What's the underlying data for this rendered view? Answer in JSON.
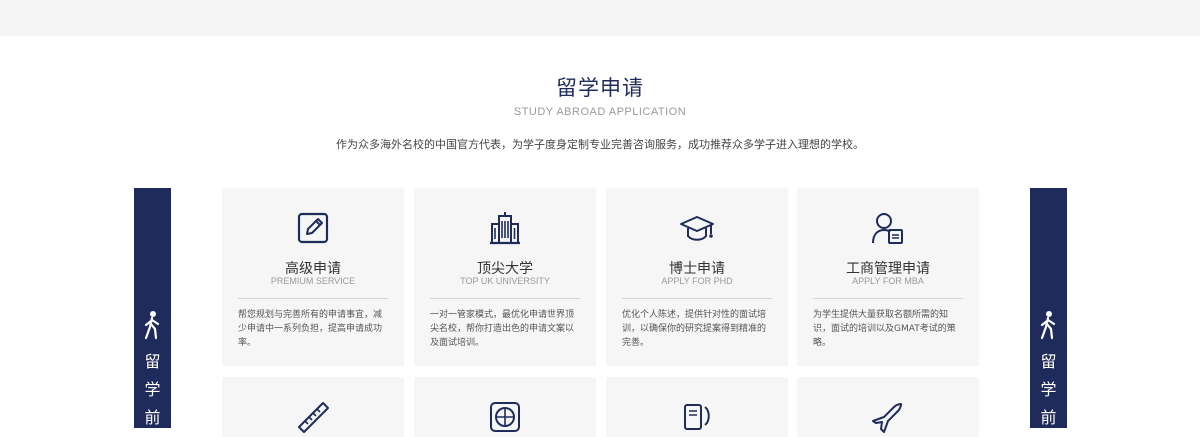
{
  "section": {
    "title": "留学申请",
    "subtitle": "STUDY ABROAD APPLICATION",
    "intro": "作为众多海外名校的中国官方代表，为学子度身定制专业完善咨询服务，成功推荐众多学子进入理想的学校。"
  },
  "sidebar_left": {
    "chars": [
      "留",
      "学",
      "前"
    ],
    "icon": "walking-person-icon"
  },
  "sidebar_right": {
    "chars": [
      "留",
      "学",
      "前"
    ],
    "icon": "walking-person-icon"
  },
  "cards": [
    {
      "title": "高级申请",
      "subtitle": "PREMIUM SERVICE",
      "description": "帮您规划与完善所有的申请事宜，减少申请中一系列负担，提高申请成功率。",
      "icon": "edit-document-icon"
    },
    {
      "title": "顶尖大学",
      "subtitle": "TOP UK UNIVERSITY",
      "description": "一对一管家模式，最优化申请世界顶尖名校，帮你打造出色的申请文案以及面试培训。",
      "icon": "university-building-icon"
    },
    {
      "title": "博士申请",
      "subtitle": "APPLY FOR PHD",
      "description": "优化个人陈述，提供针对性的面试培训，以确保你的研究提案得到精准的完善。",
      "icon": "graduation-cap-icon"
    },
    {
      "title": "工商管理申请",
      "subtitle": "APPLY FOR MBA",
      "description": "为学生提供大量获取名额所需的知识，面试的培训以及GMAT考试的策略。",
      "icon": "person-document-icon"
    }
  ],
  "cards_row2": [
    {
      "icon": "ruler-pencil-icon"
    },
    {
      "icon": "globe-icon"
    },
    {
      "icon": "phone-contact-icon"
    },
    {
      "icon": "airplane-icon"
    }
  ],
  "colors": {
    "accent": "#1f2b5b",
    "card_bg": "#f6f6f6",
    "top_bar": "#f5f5f5"
  }
}
